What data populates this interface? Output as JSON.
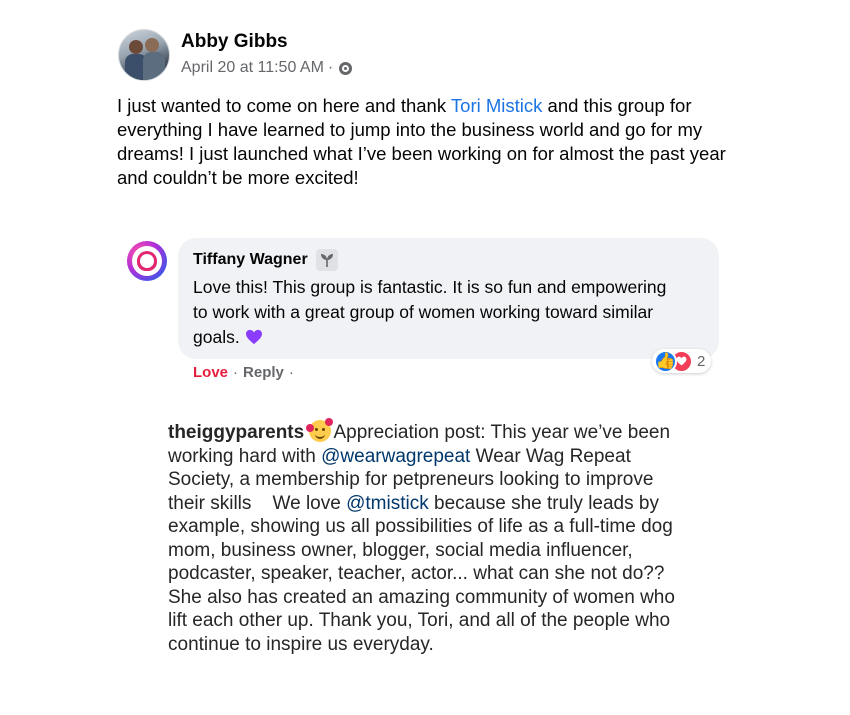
{
  "post": {
    "author": "Abby Gibbs",
    "timestamp": "April 20 at 11:50 AM",
    "separator": "·",
    "privacy_icon": "group-icon",
    "text_before_link": "I just wanted to come on here and thank ",
    "link_text": "Tori Mistick",
    "text_after_link": " and this group for everything I have learned to jump into the business world and go for my dreams! I just launched what I’ve been working on for almost the past year and couldn’t be more excited!"
  },
  "comment": {
    "author": "Tiffany Wagner",
    "badge_icon": "sprout-icon",
    "text": "Love this! This group is fantastic. It is so fun and empowering to work with a great group of women working toward similar goals.",
    "emoji": "purple-heart",
    "actions": {
      "love_label": "Love",
      "separator": "·",
      "reply_label": "Reply",
      "trailing_separator": "·"
    },
    "reactions": {
      "types": [
        "like",
        "love"
      ],
      "count": "2"
    }
  },
  "instagram": {
    "username": "theiggyparents",
    "emoji": "smiling-face-with-hearts",
    "text_1": "Appreciation post: This year we’ve been working hard with ",
    "mention_1": "@wearwagrepeat",
    "text_2": " Wear Wag Repeat Society, a membership for petpreneurs looking to improve their skills    We love ",
    "mention_2": "@tmistick",
    "text_3": " because she truly leads by example, showing us all possibilities of life as a full-time dog mom, business owner, blogger, social media influencer, podcaster, speaker, teacher, actor... what can she not do?? She also has created an amazing community of women who lift each other up. Thank you, Tori, and all of the people who continue to inspire us everyday."
  },
  "colors": {
    "link": "#1b74e4",
    "love": "#e41e3f",
    "meta": "#65676b",
    "bubble": "#f0f2f5",
    "mention": "#00376b",
    "purple_heart": "#8b3dff"
  }
}
